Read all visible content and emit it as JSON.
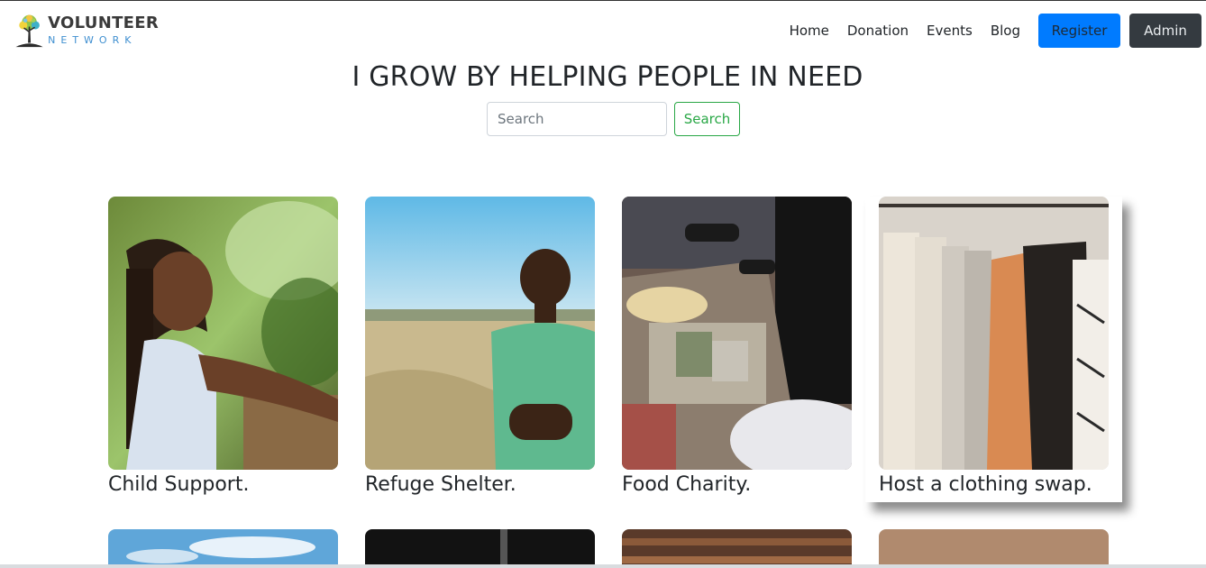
{
  "brand": {
    "name": "VOLUNTEER",
    "tagline": "NETWORK"
  },
  "nav": {
    "links": [
      {
        "label": "Home"
      },
      {
        "label": "Donation"
      },
      {
        "label": "Events"
      },
      {
        "label": "Blog"
      }
    ],
    "register_label": "Register",
    "admin_label": "Admin"
  },
  "hero": {
    "headline": "I GROW BY HELPING PEOPLE IN NEED"
  },
  "search": {
    "placeholder": "Search",
    "button_label": "Search"
  },
  "cards": [
    {
      "title": "Child Support."
    },
    {
      "title": "Refuge Shelter."
    },
    {
      "title": "Food Charity."
    },
    {
      "title": "Host a clothing swap."
    }
  ],
  "colors": {
    "primary": "#007bff",
    "dark": "#343a40",
    "success": "#28a745",
    "logo_blue": "#3f8fd0"
  }
}
